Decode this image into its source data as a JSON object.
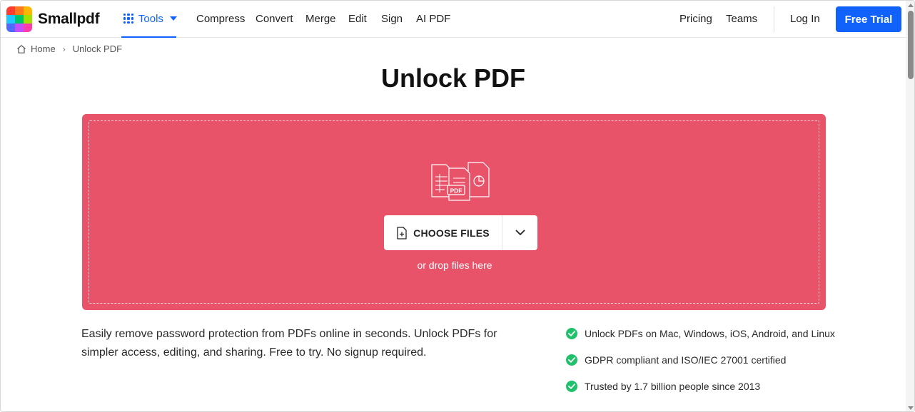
{
  "header": {
    "brand": "Smallpdf",
    "tools_label": "Tools",
    "nav": [
      "Compress",
      "Convert",
      "Merge",
      "Edit",
      "Sign",
      "AI PDF"
    ],
    "right_nav": [
      "Pricing",
      "Teams",
      "Log In"
    ],
    "trial_label": "Free Trial"
  },
  "breadcrumb": {
    "home": "Home",
    "current": "Unlock PDF"
  },
  "page": {
    "title": "Unlock PDF"
  },
  "dropzone": {
    "illustration_label": "PDF",
    "choose_label": "CHOOSE FILES",
    "hint": "or drop files here"
  },
  "description": "Easily remove password protection from PDFs online in seconds. Unlock PDFs for simpler access, editing, and sharing. Free to try. No signup required.",
  "features": [
    "Unlock PDFs on Mac, Windows, iOS, Android, and Linux",
    "GDPR compliant and ISO/IEC 27001 certified",
    "Trusted by 1.7 billion people since 2013"
  ],
  "colors": {
    "accent": "#1062fb",
    "dropzone": "#e8536a",
    "check": "#1fc16b"
  }
}
